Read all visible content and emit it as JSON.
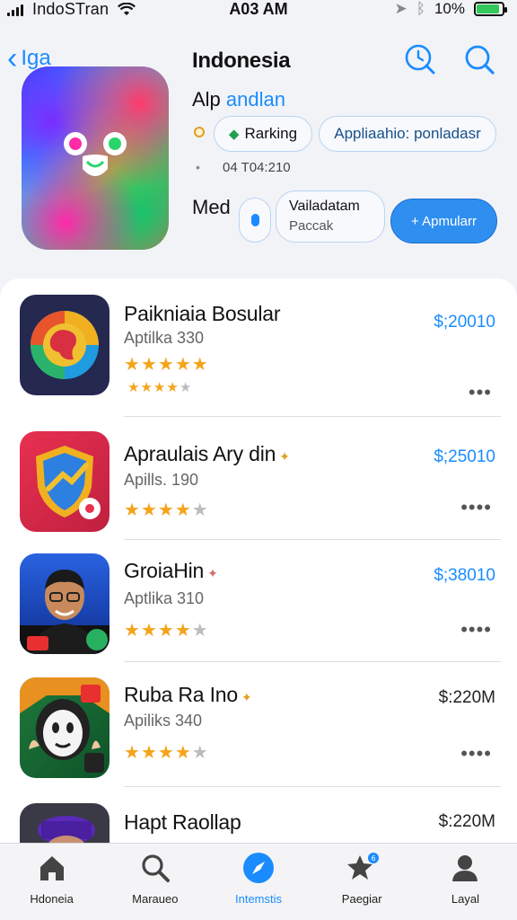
{
  "status_bar": {
    "carrier": "IndoSTran",
    "time": "A03 AM",
    "battery_pct": "10%",
    "battery_level": 0.9
  },
  "header": {
    "back_label": "Iga",
    "title": "Indonesia",
    "icons": [
      "clock-search-icon",
      "search-icon"
    ]
  },
  "app": {
    "subtitle_prefix": "Alp",
    "subtitle_accent": "andlan",
    "ranking_label": "Rarking",
    "app_pill_label": "Appliaahio: ponladasr",
    "date": "04 T04:210",
    "med_label": "Med",
    "detail_title": "Vailadatam",
    "detail_sub": "Paccak",
    "install_label": "+ Apmularr"
  },
  "list": [
    {
      "name": "Paikniaia Bosular",
      "sub": "Aptilka 330",
      "price": "$;20010",
      "price_color": "#1a8cff",
      "rating": 5,
      "subrating": 4,
      "more": "•••"
    },
    {
      "name": "Apraulais Ary din",
      "sub": "Apills. 190",
      "price": "$;25010",
      "price_color": "#1a8cff",
      "rating": 4,
      "more": "••••"
    },
    {
      "name": "GroiaHin",
      "sub": "Aptlika 310",
      "price": "$;38010",
      "price_color": "#1a8cff",
      "rating": 4,
      "more": "••••"
    },
    {
      "name": "Ruba Ra Ino",
      "sub": "Apiliks 340",
      "price": "$:220M",
      "price_color": "#222222",
      "rating": 4,
      "more": "••••"
    },
    {
      "name": "Hapt Raollap",
      "sub": "",
      "price": "$:220M",
      "price_color": "#222222",
      "rating": 0,
      "more": ""
    }
  ],
  "tabs": [
    {
      "label": "Hdoneia",
      "icon": "home-icon"
    },
    {
      "label": "Maraueo",
      "icon": "search-icon"
    },
    {
      "label": "Intemstis",
      "icon": "compass-icon",
      "active": true
    },
    {
      "label": "Paegiar",
      "icon": "star-icon"
    },
    {
      "label": "Layal",
      "icon": "person-icon"
    }
  ]
}
